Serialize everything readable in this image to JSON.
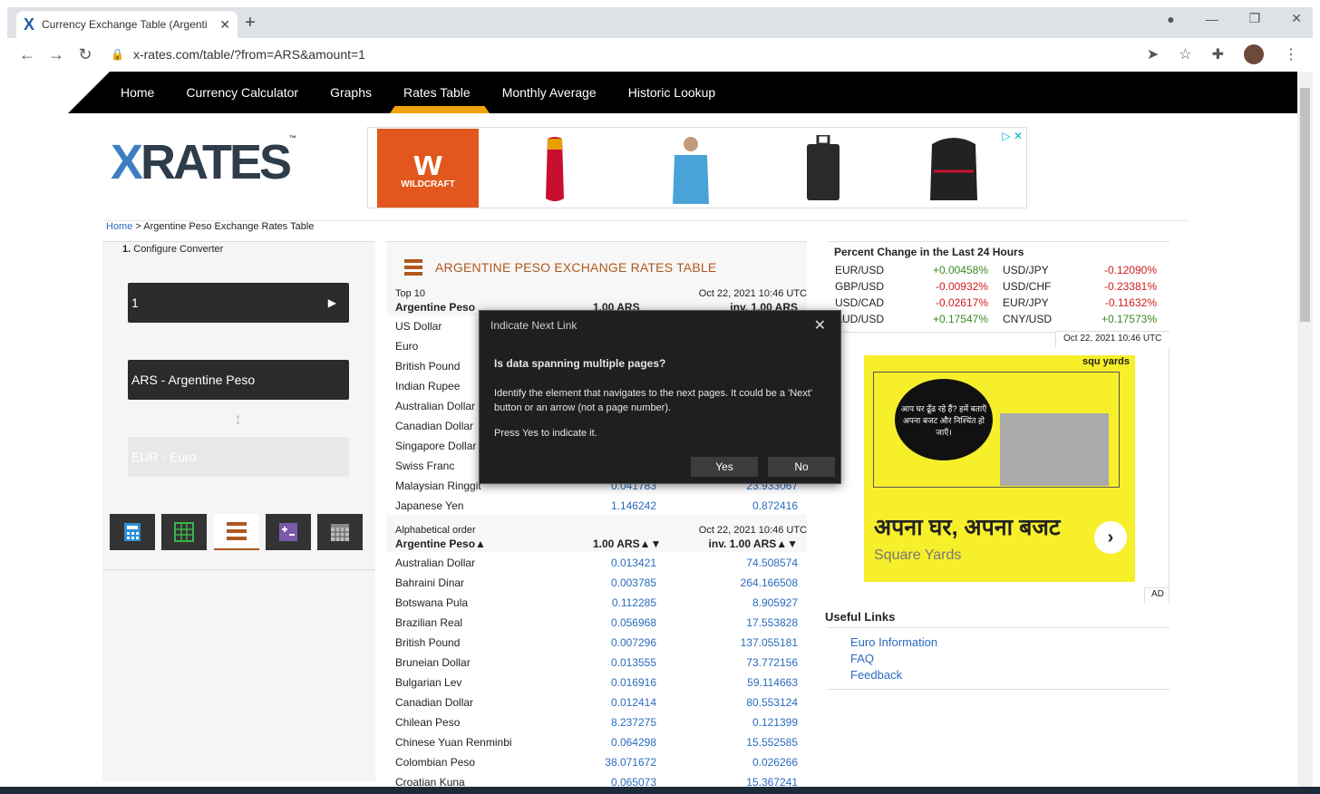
{
  "browser": {
    "tab_title": "Currency Exchange Table (Argenti",
    "tab_favicon": "X",
    "url": "x-rates.com/table/?from=ARS&amount=1"
  },
  "nav": {
    "items": [
      "Home",
      "Currency Calculator",
      "Graphs",
      "Rates Table",
      "Monthly Average",
      "Historic Lookup"
    ],
    "active": "Rates Table",
    "accent": "#f0a30a"
  },
  "logo": {
    "text_left": "X",
    "text_right": "RATES",
    "tm": "™"
  },
  "ad_banner": {
    "brand": "WILDCRAFT",
    "brand_color": "#e2571d"
  },
  "breadcrumb": {
    "home": "Home",
    "separator": " > ",
    "current": "Argentine Peso Exchange Rates Table"
  },
  "converter": {
    "step": "1.",
    "label": "Configure Converter",
    "amount": "1",
    "from": "ARS - Argentine Peso",
    "to": "EUR - Euro"
  },
  "table": {
    "title": "ARGENTINE PESO EXCHANGE RATES TABLE",
    "title_color": "#b0581e",
    "top10": {
      "label": "Top 10",
      "timestamp": "Oct 22, 2021 10:46 UTC",
      "col1": "Argentine Peso",
      "col2": "1.00 ARS",
      "col3": "inv. 1.00 ARS",
      "rows": [
        {
          "name": "US Dollar",
          "v1": "",
          "v2": ""
        },
        {
          "name": "Euro",
          "v1": "",
          "v2": ""
        },
        {
          "name": "British Pound",
          "v1": "",
          "v2": ""
        },
        {
          "name": "Indian Rupee",
          "v1": "",
          "v2": ""
        },
        {
          "name": "Australian Dollar",
          "v1": "",
          "v2": ""
        },
        {
          "name": "Canadian Dollar",
          "v1": "",
          "v2": ""
        },
        {
          "name": "Singapore Dollar",
          "v1": "",
          "v2": ""
        },
        {
          "name": "Swiss Franc",
          "v1": "",
          "v2": ""
        },
        {
          "name": "Malaysian Ringgit",
          "v1": "0.041783",
          "v2": "23.933067"
        },
        {
          "name": "Japanese Yen",
          "v1": "1.146242",
          "v2": "0.872416"
        }
      ]
    },
    "alpha": {
      "label": "Alphabetical order",
      "timestamp": "Oct 22, 2021 10:46 UTC",
      "col1": "Argentine Peso▲",
      "col2": "1.00 ARS▲▼",
      "col3": "inv. 1.00 ARS▲▼",
      "rows": [
        {
          "name": "Australian Dollar",
          "v1": "0.013421",
          "v2": "74.508574"
        },
        {
          "name": "Bahraini Dinar",
          "v1": "0.003785",
          "v2": "264.166508"
        },
        {
          "name": "Botswana Pula",
          "v1": "0.112285",
          "v2": "8.905927"
        },
        {
          "name": "Brazilian Real",
          "v1": "0.056968",
          "v2": "17.553828"
        },
        {
          "name": "British Pound",
          "v1": "0.007296",
          "v2": "137.055181"
        },
        {
          "name": "Bruneian Dollar",
          "v1": "0.013555",
          "v2": "73.772156"
        },
        {
          "name": "Bulgarian Lev",
          "v1": "0.016916",
          "v2": "59.114663"
        },
        {
          "name": "Canadian Dollar",
          "v1": "0.012414",
          "v2": "80.553124"
        },
        {
          "name": "Chilean Peso",
          "v1": "8.237275",
          "v2": "0.121399"
        },
        {
          "name": "Chinese Yuan Renminbi",
          "v1": "0.064298",
          "v2": "15.552585"
        },
        {
          "name": "Colombian Peso",
          "v1": "38.071672",
          "v2": "0.026266"
        },
        {
          "name": "Croatian Kuna",
          "v1": "0.065073",
          "v2": "15.367241"
        }
      ]
    }
  },
  "percent_change": {
    "title": "Percent Change in the Last 24 Hours",
    "timestamp": "Oct 22, 2021 10:46 UTC",
    "left": [
      {
        "pair": "EUR/USD",
        "value": "+0.00458%",
        "dir": "pos"
      },
      {
        "pair": "GBP/USD",
        "value": "-0.00932%",
        "dir": "neg"
      },
      {
        "pair": "USD/CAD",
        "value": "-0.02617%",
        "dir": "neg"
      },
      {
        "pair": "AUD/USD",
        "value": "+0.17547%",
        "dir": "pos"
      }
    ],
    "right": [
      {
        "pair": "USD/JPY",
        "value": "-0.12090%",
        "dir": "neg"
      },
      {
        "pair": "USD/CHF",
        "value": "-0.23381%",
        "dir": "neg"
      },
      {
        "pair": "EUR/JPY",
        "value": "-0.11632%",
        "dir": "neg"
      },
      {
        "pair": "CNY/USD",
        "value": "+0.17573%",
        "dir": "pos"
      }
    ]
  },
  "ad_square": {
    "headline": "अपना घर, अपना बजट",
    "brand": "Square Yards",
    "logo": "squ yards",
    "circle_text": "आप घर ढूँढ रहे हैं? हमें बताएँ अपना बजट और निश्चिंत हो जाएँ।",
    "ad_label": "AD"
  },
  "useful_links": {
    "title": "Useful Links",
    "items": [
      "Euro Information",
      "FAQ",
      "Feedback"
    ]
  },
  "dialog": {
    "title": "Indicate Next Link",
    "question": "Is data spanning multiple pages?",
    "body": "Identify the element that navigates to the next pages. It could be a 'Next' button or an arrow (not a page number).",
    "prompt": "Press Yes to indicate it.",
    "yes": "Yes",
    "no": "No"
  }
}
